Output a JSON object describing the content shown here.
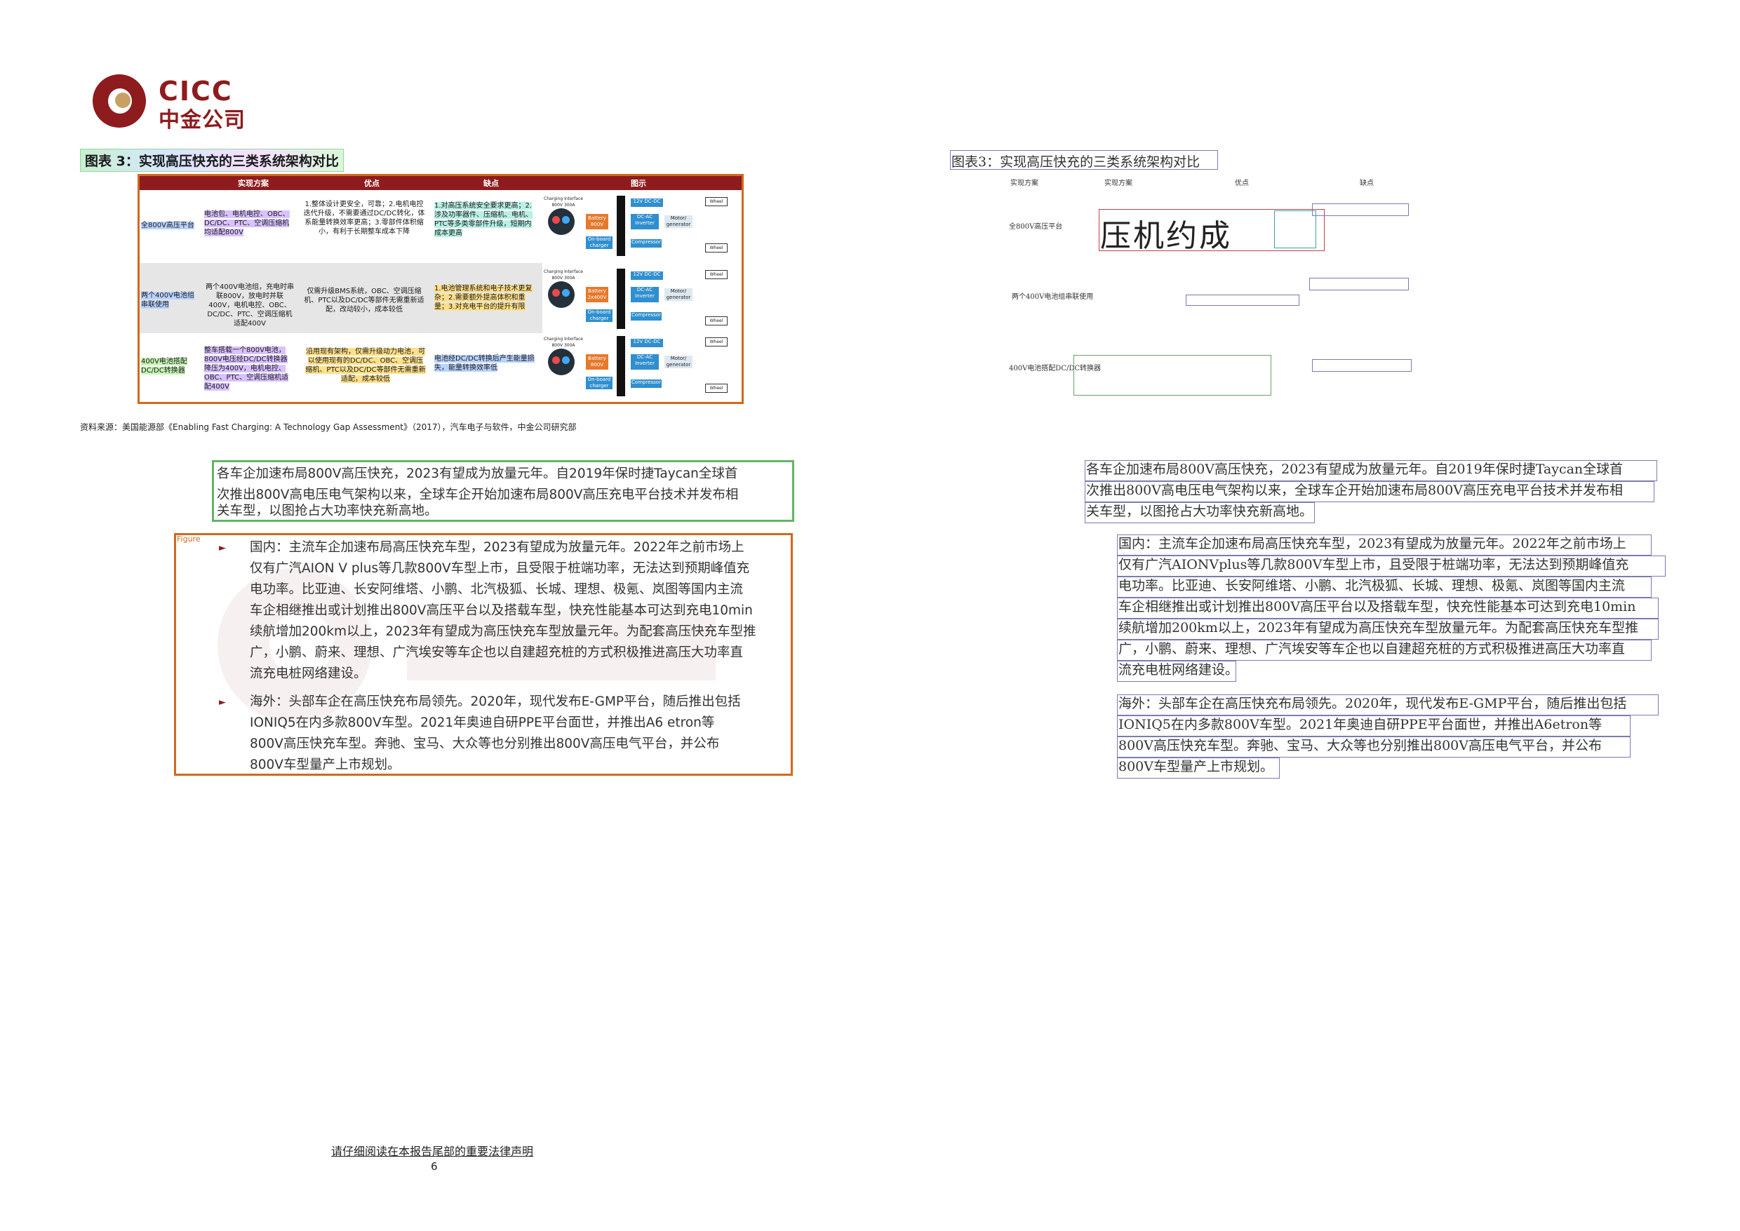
{
  "logo": {
    "en": "CICC",
    "cn": "中金公司"
  },
  "figure": {
    "title": "图表 3：实现高压快充的三类系统架构对比",
    "tag": "Figure",
    "headers": [
      "实现方案",
      "优点",
      "缺点",
      "图示"
    ],
    "rows": [
      {
        "plan": "全800V高压平台",
        "approach": "电池包、电机电控、OBC、DC/DC、PTC、空调压缩机均适配800V",
        "pros": "1.整体设计更安全，可靠；2.电机电控迭代升级，不需要通过DC/DC转化，体系能量转换效率更高；3.零部件体积缩小，有利于长期整车成本下降",
        "cons": "1.对高压系统安全要求更高；2.涉及功率器件、压缩机、电机、PTC等多类零部件升级，短期内成本更高",
        "diagram": {
          "interface": "Charging Interface 800V 300A",
          "battery": "Battery 800V",
          "inverter": "DC-AC Inverter",
          "dcdc": "12V DC-DC",
          "motor": "Motor/ generator",
          "charger": "On-board charger",
          "compressor": "Compressor",
          "wheel": "Wheel",
          "bus": "800V DC BUS"
        }
      },
      {
        "plan": "两个400V电池组串联使用",
        "approach": "两个400V电池组，充电时串联800V，放电时并联400V，电机电控、OBC、DC/DC、PTC、空调压缩机适配400V",
        "pros": "仅需升级BMS系统，OBC、空调压缩机、PTC以及DC/DC等部件无需重新适配，改动较小，成本较低",
        "cons": "1.电池管理系统和电子技术更复杂；2.需要额外提高体积和重量；3.对充电平台的提升有限",
        "diagram": {
          "interface": "Charging Interface 800V 300A",
          "battery": "Battery 2x400V",
          "inverter": "DC-AC Inverter",
          "dcdc": "12V DC-DC",
          "motor": "Motor/ generator",
          "charger": "On-board charger",
          "compressor": "Compressor",
          "wheel": "Wheel",
          "bus": "400V DC BUS"
        }
      },
      {
        "plan": "400V电池搭配DC/DC转换器",
        "approach": "整车搭载一个800V电池，800V电压经DC/DC转换器降压为400V，电机电控、OBC、PTC、空调压缩机适配400V",
        "pros": "沿用现有架构，仅需升级动力电池，可以使用现有的DC/DC、OBC、空调压缩机、PTC以及DC/DC等部件无需重新适配，成本较低",
        "cons": "电池经DC/DC转换后产生能量损失，能量转换效率低",
        "diagram": {
          "interface": "Charging Interface 800V 300A",
          "battery": "Battery 800V",
          "inverter": "DC-AC Inverter",
          "dcdc": "12V DC-DC",
          "motor": "Motor/ generator",
          "charger": "On-board charger",
          "compressor": "Compressor",
          "wheel": "Wheel",
          "bus": "800V-400V DC"
        }
      }
    ],
    "source": "资料来源：美国能源部《Enabling Fast Charging: A Technology Gap Assessment》（2017），汽车电子与软件，中金公司研究部"
  },
  "body": {
    "para_lines": [
      "各车企加速布局800V高压快充，2023有望成为放量元年。自2019年保时捷Taycan全球首",
      "次推出800V高电压电气架构以来，全球车企开始加速布局800V高压充电平台技术并发布相",
      "关车型，以图抢占大功率快充新高地。"
    ],
    "domestic_lines": [
      "国内：主流车企加速布局高压快充车型，2023有望成为放量元年。2022年之前市场上",
      "仅有广汽AION V plus等几款800V车型上市，且受限于桩端功率，无法达到预期峰值充",
      "电功率。比亚迪、长安阿维塔、小鹏、北汽极狐、长城、理想、极氪、岚图等国内主流",
      "车企相继推出或计划推出800V高压平台以及搭载车型，快充性能基本可达到充电10min",
      "续航增加200km以上，2023年有望成为高压快充车型放量元年。为配套高压快充车型推",
      "广，小鹏、蔚来、理想、广汽埃安等车企也以自建超充桩的方式积极推进高压大功率直",
      "流充电桩网络建设。"
    ],
    "overseas_lines": [
      "海外：头部车企在高压快充布局领先。2020年，现代发布E-GMP平台，随后推出包括",
      "IONIQ5在内多款800V车型。2021年奥迪自研PPE平台面世，并推出A6 etron等",
      "800V高压快充车型。奔驰、宝马、大众等也分别推出800V高压电气平台，并公布",
      "800V车型量产上市规划。"
    ]
  },
  "footer": {
    "note": "请仔细阅读在本报告尾部的重要法律声明",
    "page": "6"
  },
  "ocr": {
    "title": "图表3：实现高压快充的三类系统架构对比",
    "headers": [
      "实现方案",
      "实现方案",
      "优点",
      "缺点"
    ],
    "big_text": "压机约成",
    "row_labels": [
      "全800V高压平台",
      "两个400V电池组串联使用",
      "400V电池搭配DC/DC转换器"
    ],
    "para_lines": [
      "各车企加速布局800V高压快充，2023有望成为放量元年。自2019年保时捷Taycan全球首",
      "次推出800V高电压电气架构以来，全球车企开始加速布局800V高压充电平台技术并发布相",
      "关车型，以图抢占大功率快充新高地。"
    ],
    "domestic_lines": [
      "国内：主流车企加速布局高压快充车型，2023有望成为放量元年。2022年之前市场上",
      "仅有广汽AIONVplus等几款800V车型上市，且受限于桩端功率，无法达到预期峰值充",
      "电功率。比亚迪、长安阿维塔、小鹏、北汽极狐、长城、理想、极氪、岚图等国内主流",
      "车企相继推出或计划推出800V高压平台以及搭载车型，快充性能基本可达到充电10min",
      "续航增加200km以上，2023年有望成为高压快充车型放量元年。为配套高压快充车型推",
      "广，小鹏、蔚来、理想、广汽埃安等车企也以自建超充桩的方式积极推进高压大功率直",
      "流充电桩网络建设。"
    ],
    "overseas_lines": [
      "海外：头部车企在高压快充布局领先。2020年，现代发布E-GMP平台，随后推出包括",
      "IONIQ5在内多款800V车型。2021年奥迪自研PPE平台面世，并推出A6etron等",
      "800V高压快充车型。奔驰、宝马、大众等也分别推出800V高压电气平台，并公布",
      "800V车型量产上市规划。"
    ]
  }
}
